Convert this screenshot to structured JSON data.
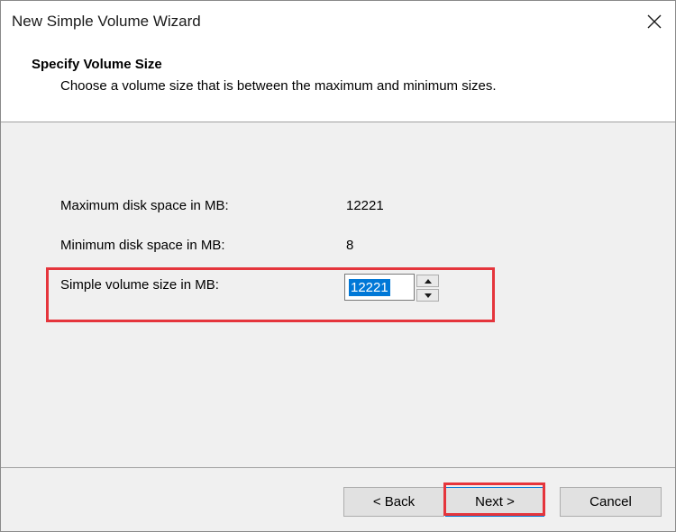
{
  "window": {
    "title": "New Simple Volume Wizard"
  },
  "header": {
    "title": "Specify Volume Size",
    "subtitle": "Choose a volume size that is between the maximum and minimum sizes."
  },
  "fields": {
    "max_label": "Maximum disk space in MB:",
    "max_value": "12221",
    "min_label": "Minimum disk space in MB:",
    "min_value": "8",
    "size_label": "Simple volume size in MB:",
    "size_value": "12221"
  },
  "buttons": {
    "back": "< Back",
    "next": "Next >",
    "cancel": "Cancel"
  },
  "colors": {
    "highlight": "#e5353c",
    "selection": "#0078d7"
  },
  "icons": {
    "close": "close-icon",
    "spin_up": "arrow-up-icon",
    "spin_down": "arrow-down-icon"
  }
}
